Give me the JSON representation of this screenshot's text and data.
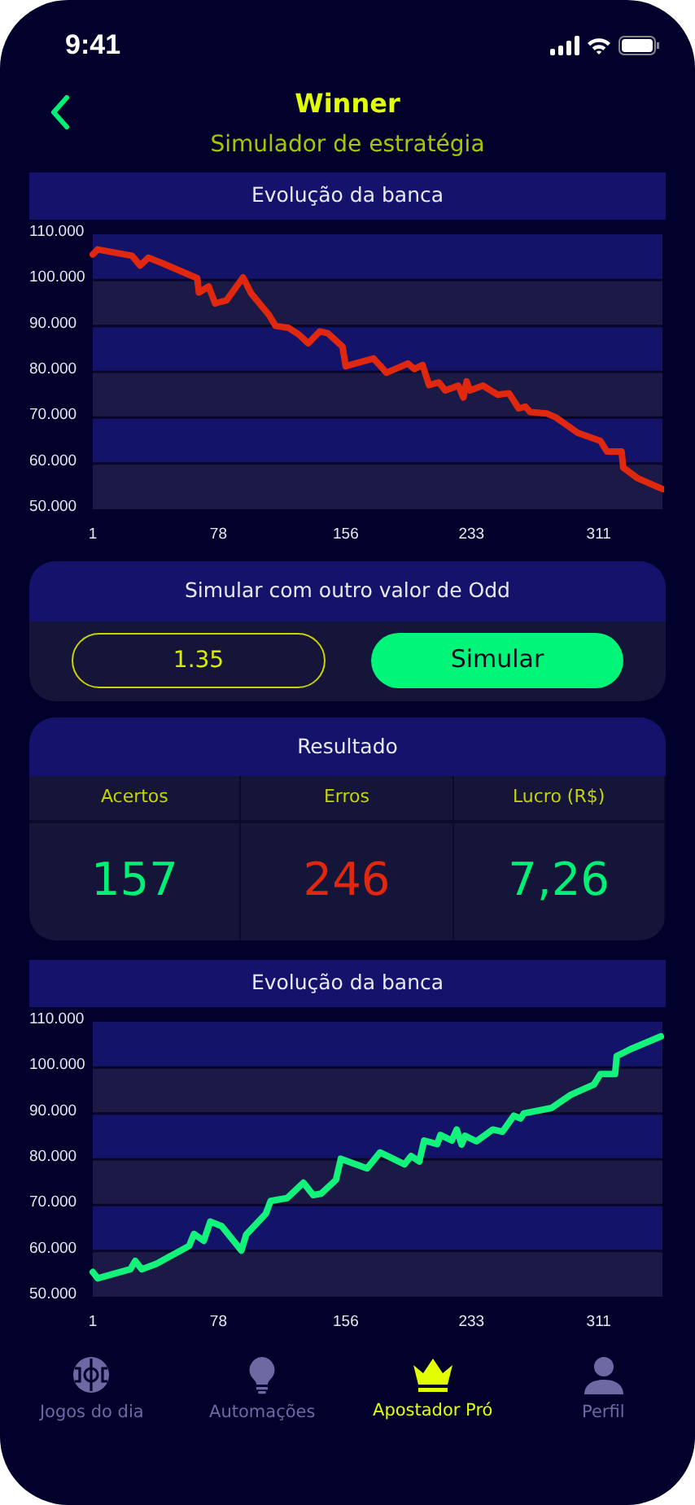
{
  "status_bar": {
    "time": "9:41"
  },
  "header": {
    "title": "Winner",
    "subtitle": "Simulador de estratégia"
  },
  "chart_card_top": {
    "title": "Evolução da banca",
    "chart_data": {
      "type": "line",
      "grid": true,
      "bands": [
        {
          "axis": "y",
          "from": 50,
          "to": 60,
          "color": "#1b1946"
        },
        {
          "axis": "y",
          "from": 60,
          "to": 70,
          "color": "#14136a"
        },
        {
          "axis": "y",
          "from": 70,
          "to": 80,
          "color": "#1b1946"
        },
        {
          "axis": "y",
          "from": 80,
          "to": 90,
          "color": "#14136a"
        },
        {
          "axis": "y",
          "from": 90,
          "to": 100,
          "color": "#1b1946"
        },
        {
          "axis": "y",
          "from": 100,
          "to": 110,
          "color": "#14136a"
        }
      ],
      "xlim": [
        1,
        350
      ],
      "ylim": [
        50,
        110
      ],
      "xticks": [
        1,
        78,
        156,
        233,
        311
      ],
      "yticks": [
        {
          "value": 50,
          "label": "50.000"
        },
        {
          "value": 60,
          "label": "60.000"
        },
        {
          "value": 70,
          "label": "70.000"
        },
        {
          "value": 80,
          "label": "80.000"
        },
        {
          "value": 90,
          "label": "90.000"
        },
        {
          "value": 100,
          "label": "100.000"
        },
        {
          "value": 110,
          "label": "110.000"
        }
      ],
      "x": [
        1,
        4,
        25,
        30,
        35,
        43,
        65,
        66,
        72,
        76,
        83,
        93,
        98,
        109,
        113,
        121,
        127,
        133,
        140,
        145,
        154,
        156,
        173,
        181,
        194,
        198,
        203,
        207,
        213,
        217,
        225,
        228,
        230,
        232,
        240,
        249,
        256,
        262,
        266,
        269,
        279,
        285,
        298,
        312,
        316,
        325,
        326,
        335,
        350
      ],
      "series": [
        {
          "color": "#e0280e",
          "values": [
            105.6,
            106.7,
            105.3,
            103.2,
            104.9,
            103.8,
            100.4,
            97.3,
            98.6,
            94.9,
            95.6,
            100.6,
            97.1,
            92.4,
            90.0,
            89.6,
            88.2,
            86.2,
            88.8,
            88.4,
            85.5,
            81.2,
            82.9,
            79.8,
            81.8,
            80.6,
            81.5,
            77.1,
            77.7,
            75.9,
            77.0,
            74.4,
            77.9,
            75.9,
            77.0,
            75.0,
            75.3,
            72.0,
            72.4,
            71.2,
            70.9,
            70.0,
            66.7,
            64.9,
            62.6,
            62.6,
            59.1,
            56.7,
            54.4
          ]
        }
      ]
    }
  },
  "odd_card": {
    "title": "Simular com outro valor de Odd",
    "odd_value": "1.35",
    "button": "Simular"
  },
  "result_card": {
    "title": "Resultado",
    "columns": [
      {
        "label": "Acertos",
        "value": "157",
        "color": "#00f076"
      },
      {
        "label": "Erros",
        "value": "246",
        "color": "#e0280e"
      },
      {
        "label": "Lucro (R$)",
        "value": "7,26",
        "color": "#00f076"
      }
    ]
  },
  "chart_card_bottom": {
    "title": "Evolução da banca",
    "chart_data": {
      "type": "line",
      "grid": true,
      "bands": [
        {
          "axis": "y",
          "from": 50,
          "to": 60,
          "color": "#1b1946"
        },
        {
          "axis": "y",
          "from": 60,
          "to": 70,
          "color": "#14136a"
        },
        {
          "axis": "y",
          "from": 70,
          "to": 80,
          "color": "#1b1946"
        },
        {
          "axis": "y",
          "from": 80,
          "to": 90,
          "color": "#14136a"
        },
        {
          "axis": "y",
          "from": 90,
          "to": 100,
          "color": "#1b1946"
        },
        {
          "axis": "y",
          "from": 100,
          "to": 110,
          "color": "#14136a"
        }
      ],
      "xlim": [
        1,
        350
      ],
      "ylim": [
        50,
        110
      ],
      "xticks": [
        1,
        78,
        156,
        233,
        311
      ],
      "yticks": [
        {
          "value": 50,
          "label": "50.000"
        },
        {
          "value": 60,
          "label": "60.000"
        },
        {
          "value": 70,
          "label": "70.000"
        },
        {
          "value": 80,
          "label": "80.000"
        },
        {
          "value": 90,
          "label": "90.000"
        },
        {
          "value": 100,
          "label": "100.000"
        },
        {
          "value": 110,
          "label": "110.000"
        }
      ],
      "x": [
        1,
        4,
        24,
        27,
        31,
        40,
        60,
        63,
        69,
        73,
        80,
        92,
        95,
        107,
        110,
        120,
        130,
        136,
        141,
        150,
        153,
        169,
        177,
        192,
        196,
        201,
        204,
        212,
        214,
        221,
        224,
        227,
        229,
        236,
        246,
        252,
        259,
        263,
        265,
        282,
        294,
        308,
        312,
        321,
        322,
        331,
        349
      ],
      "series": [
        {
          "color": "#13f27a",
          "values": [
            55.4,
            54.0,
            56.0,
            57.8,
            56.0,
            57.2,
            61.1,
            63.7,
            62.2,
            66.4,
            65.4,
            60.1,
            63.6,
            68.1,
            70.9,
            71.5,
            74.9,
            72.2,
            72.5,
            75.5,
            80.1,
            78.0,
            81.5,
            78.9,
            80.7,
            79.5,
            84.1,
            83.3,
            85.3,
            84.1,
            86.5,
            83.2,
            85.1,
            83.9,
            86.5,
            86.0,
            89.5,
            88.9,
            90.0,
            91.2,
            94.1,
            96.3,
            98.6,
            98.6,
            102.5,
            104.1,
            106.8
          ]
        }
      ]
    }
  },
  "bottom_nav": [
    {
      "label": "Jogos do dia",
      "selected": false
    },
    {
      "label": "Automações",
      "selected": false
    },
    {
      "label": "Apostador Pró",
      "selected": true
    },
    {
      "label": "Perfil",
      "selected": false
    }
  ]
}
